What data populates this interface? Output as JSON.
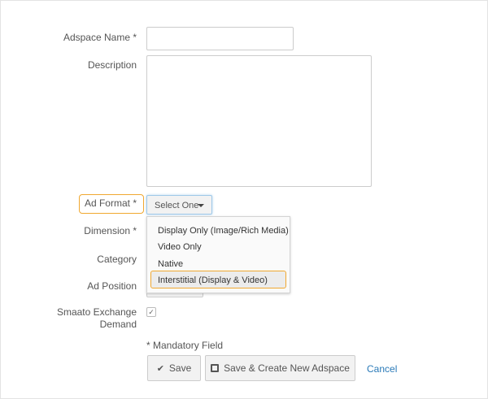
{
  "form": {
    "adspace_name_label": "Adspace Name *",
    "description_label": "Description",
    "ad_format_label": "Ad Format *",
    "ad_format_value": "Select One",
    "ad_format_options": [
      "Display Only (Image/Rich Media)",
      "Video Only",
      "Native",
      "Interstitial (Display & Video)"
    ],
    "dimension_label": "Dimension *",
    "category_label": "Category",
    "ad_position_label": "Ad Position",
    "smaato_label_1": "Smaato Exchange",
    "smaato_label_2": "Demand",
    "smaato_checked": true,
    "mandatory_note": "* Mandatory Field"
  },
  "buttons": {
    "save": "Save",
    "save_create": "Save & Create New Adspace",
    "cancel": "Cancel"
  },
  "colors": {
    "highlight": "#f0a830",
    "link": "#2a7ab8"
  }
}
